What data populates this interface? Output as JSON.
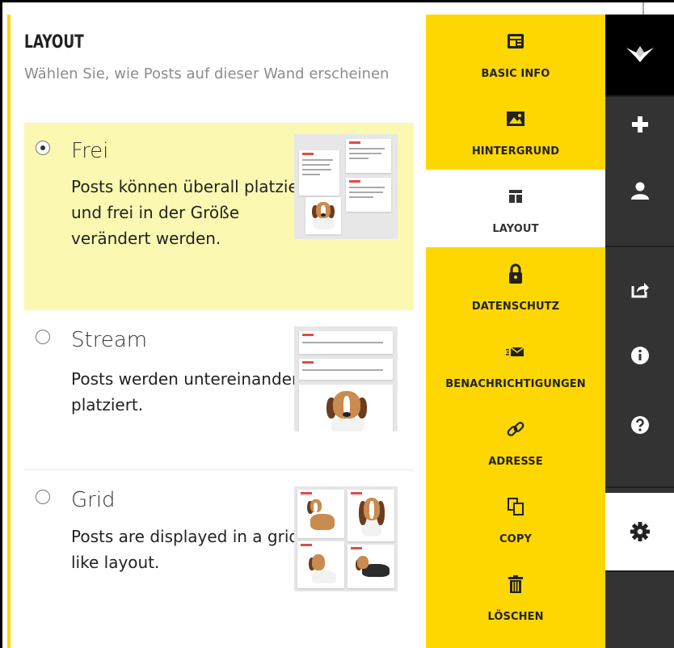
{
  "layout": {
    "title": "LAYOUT",
    "subtitle": "Wählen Sie, wie Posts auf dieser Wand erscheinen",
    "options": [
      {
        "id": "frei",
        "title": "Frei",
        "description": "Posts können überall platziert und frei in der Größe verändert werden.",
        "selected": true
      },
      {
        "id": "stream",
        "title": "Stream",
        "description": "Posts werden untereinander platziert.",
        "selected": false
      },
      {
        "id": "grid",
        "title": "Grid",
        "description": "Posts are displayed in a grid-like layout.",
        "selected": false
      }
    ]
  },
  "settings_menu": {
    "items": [
      {
        "label": "BASIC INFO",
        "icon": "basic-info-icon",
        "active": false
      },
      {
        "label": "HINTERGRUND",
        "icon": "image-icon",
        "active": false
      },
      {
        "label": "LAYOUT",
        "icon": "layout-icon",
        "active": true
      },
      {
        "label": "DATENSCHUTZ",
        "icon": "lock-icon",
        "active": false
      },
      {
        "label": "BENACHRICHTIGUNGEN",
        "icon": "mail-icon",
        "active": false
      },
      {
        "label": "ADRESSE",
        "icon": "link-icon",
        "active": false
      },
      {
        "label": "COPY",
        "icon": "copy-icon",
        "active": false
      },
      {
        "label": "LÖSCHEN",
        "icon": "trash-icon",
        "active": false
      }
    ]
  },
  "sidebar": {
    "icons": [
      "crane-logo-icon",
      "plus-icon",
      "user-icon",
      "share-icon",
      "info-icon",
      "help-icon",
      "gear-icon"
    ]
  },
  "colors": {
    "accent": "#ffd700",
    "selected_option_bg": "#fbf8b1",
    "sidebar_bg": "#333333",
    "logo_bg": "#000000"
  }
}
